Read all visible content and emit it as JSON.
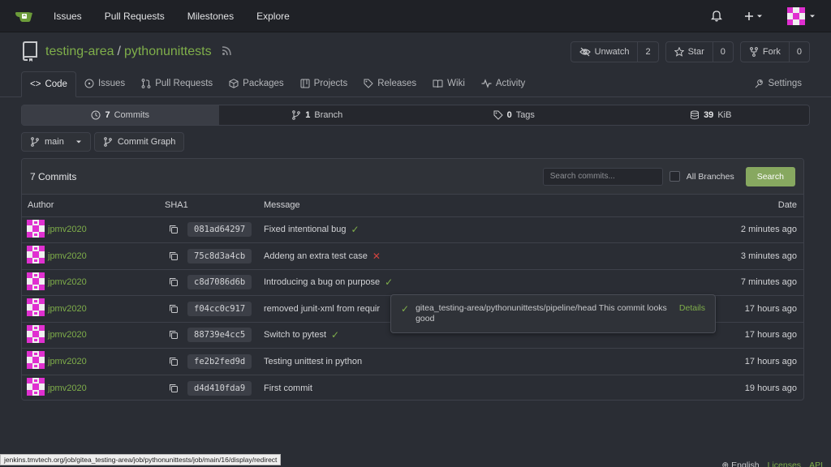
{
  "topnav": {
    "links": [
      "Issues",
      "Pull Requests",
      "Milestones",
      "Explore"
    ],
    "icons": [
      "bell-icon",
      "plus-icon",
      "avatar"
    ]
  },
  "repo": {
    "owner": "testing-area",
    "separator": "/",
    "name": "pythonunittests",
    "unwatch_label": "Unwatch",
    "unwatch_count": "2",
    "star_label": "Star",
    "star_count": "0",
    "fork_label": "Fork",
    "fork_count": "0"
  },
  "tabs": {
    "code": "Code",
    "issues": "Issues",
    "pulls": "Pull Requests",
    "packages": "Packages",
    "projects": "Projects",
    "releases": "Releases",
    "wiki": "Wiki",
    "activity": "Activity",
    "settings": "Settings"
  },
  "stats": {
    "commits_num": "7",
    "commits_label": "Commits",
    "branch_num": "1",
    "branch_label": "Branch",
    "tags_num": "0",
    "tags_label": "Tags",
    "size_num": "39",
    "size_label": "KiB"
  },
  "branch": {
    "current": "main",
    "graph_label": "Commit Graph"
  },
  "commits_box": {
    "title": "7 Commits",
    "search_placeholder": "Search commits...",
    "all_branches_label": "All Branches",
    "search_button": "Search",
    "headers": {
      "author": "Author",
      "sha": "SHA1",
      "message": "Message",
      "date": "Date"
    },
    "rows": [
      {
        "author": "jpmv2020",
        "sha": "081ad64297",
        "message": "Fixed intentional bug",
        "status": "ok",
        "date": "2 minutes ago"
      },
      {
        "author": "jpmv2020",
        "sha": "75c8d3a4cb",
        "message": "Addeng an extra test case",
        "status": "fail",
        "date": "3 minutes ago"
      },
      {
        "author": "jpmv2020",
        "sha": "c8d7086d6b",
        "message": "Introducing a bug on purpose",
        "status": "ok",
        "date": "7 minutes ago"
      },
      {
        "author": "jpmv2020",
        "sha": "f04cc0c917",
        "message": "removed junit-xml from requir",
        "status": "",
        "date": "17 hours ago"
      },
      {
        "author": "jpmv2020",
        "sha": "88739e4cc5",
        "message": "Switch to pytest",
        "status": "ok",
        "date": "17 hours ago"
      },
      {
        "author": "jpmv2020",
        "sha": "fe2b2fed9d",
        "message": "Testing unittest in python",
        "status": "",
        "date": "17 hours ago"
      },
      {
        "author": "jpmv2020",
        "sha": "d4d410fda9",
        "message": "First commit",
        "status": "",
        "date": "19 hours ago"
      }
    ]
  },
  "tooltip": {
    "text": "gitea_testing-area/pythonunittests/pipeline/head This commit looks good",
    "link": "Details"
  },
  "statusbar": {
    "url": "jenkins.tmvtech.org/job/gitea_testing-area/job/pythonunittests/job/main/16/display/redirect"
  },
  "footer": {
    "language": "English",
    "licenses": "Licenses",
    "api": "API"
  },
  "colors": {
    "accent": "#7fae4a",
    "fail": "#d1443f",
    "search_button": "#87a860"
  }
}
